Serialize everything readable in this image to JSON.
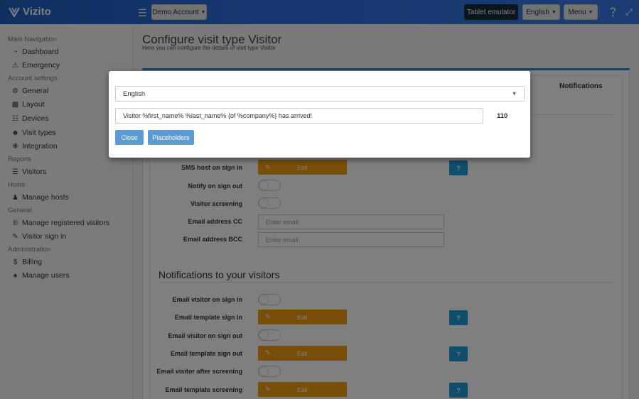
{
  "brand": {
    "name": "Vizito"
  },
  "header": {
    "account_label": "Demo Account",
    "tablet_label": "Tablet emulator",
    "language_label": "English",
    "menu_label": "Menu"
  },
  "sidebar": {
    "sections": [
      {
        "title": "Main Navigation",
        "items": [
          "Dashboard",
          "Emergency"
        ]
      },
      {
        "title": "Account settings",
        "items": [
          "General",
          "Layout",
          "Devices",
          "Visit types",
          "Integration"
        ]
      },
      {
        "title": "Reports",
        "items": [
          "Visitors"
        ]
      },
      {
        "title": "Hosts",
        "items": [
          "Manage hosts"
        ]
      },
      {
        "title": "General",
        "items": [
          "Manage registered visitors",
          "Visitor sign in"
        ]
      },
      {
        "title": "Administration",
        "items": [
          "Billing",
          "Manage users"
        ]
      }
    ]
  },
  "page": {
    "title": "Configure visit type Visitor",
    "subtitle": "Here you can configure the details of visit type Visitor",
    "notifications_tab": "Notifications"
  },
  "host_rows": {
    "sms_host": "SMS host on sign in",
    "notify_sign_out": "Notify on sign out",
    "visitor_screening": "Visitor screening",
    "email_cc": "Email address CC",
    "email_bcc": "Email address BCC"
  },
  "placeholders": {
    "email": "Enter email"
  },
  "buttons": {
    "edit": "Edit",
    "help": "?"
  },
  "visitors_section": {
    "title": "Notifications to your visitors",
    "rows": {
      "email_sign_in": "Email visitor on sign in",
      "template_sign_in": "Email template sign in",
      "email_sign_out": "Email visitor on sign out",
      "template_sign_out": "Email template sign out",
      "email_after_screening": "Email visitor after screening",
      "template_screening": "Email template screening"
    }
  },
  "modal": {
    "language": "English",
    "message": "Visitor %first_name% %last_name% {of %company%} has arrived!",
    "char_count": "110",
    "close_label": "Close",
    "placeholders_label": "Placeholders"
  },
  "colors": {
    "navbar": "#2d6ee0",
    "edit_button": "#f39c12",
    "help_button": "#1e9ad6",
    "modal_button": "#5b9bd5"
  }
}
